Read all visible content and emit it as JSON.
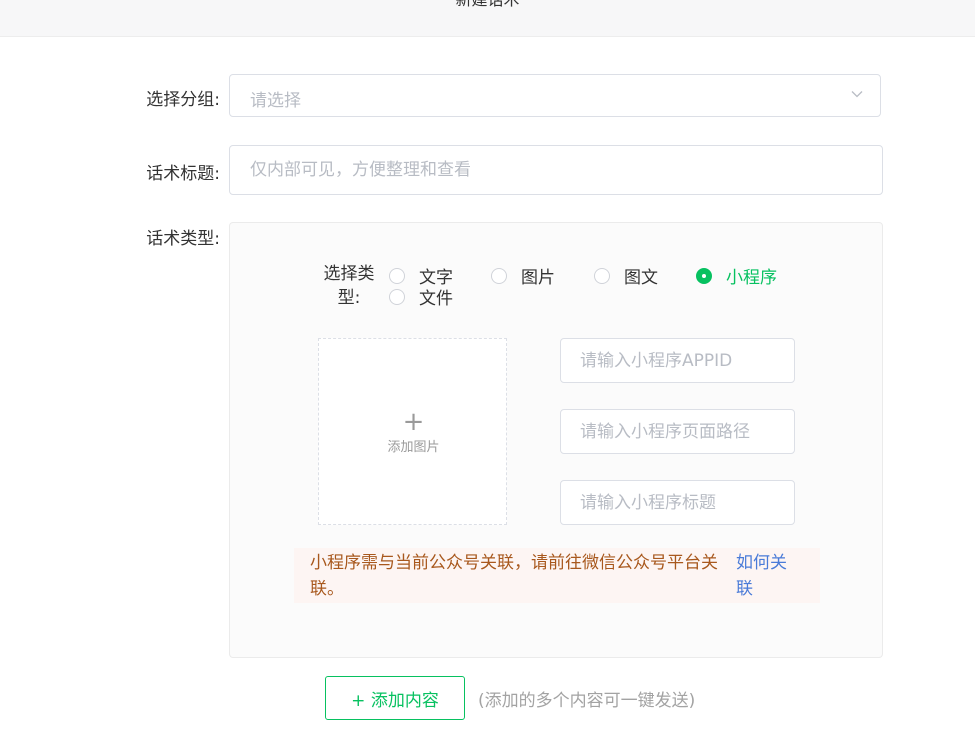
{
  "header": {
    "title": "新建话术"
  },
  "form": {
    "group_label": "选择分组:",
    "group_placeholder": "请选择",
    "title_label": "话术标题:",
    "title_placeholder": "仅内部可见，方便整理和查看",
    "type_label": "话术类型:"
  },
  "content": {
    "select_type_label": "选择类型:",
    "types": [
      {
        "label": "文字",
        "checked": false
      },
      {
        "label": "图片",
        "checked": false
      },
      {
        "label": "图文",
        "checked": false
      },
      {
        "label": "小程序",
        "checked": true
      },
      {
        "label": "文件",
        "checked": false
      }
    ],
    "upload_label": "添加图片",
    "upload_icon": "plus-icon",
    "appid_placeholder": "请输入小程序APPID",
    "path_placeholder": "请输入小程序页面路径",
    "mp_title_placeholder": "请输入小程序标题",
    "warning_text": "小程序需与当前公众号关联，请前往微信公众号平台关联。",
    "warning_link": "如何关联"
  },
  "footer": {
    "add_button": "+ 添加内容",
    "hint": "(添加的多个内容可一键发送)"
  },
  "colors": {
    "accent": "#07c160",
    "link": "#4a7bd8",
    "warning_text": "#a8581d",
    "warning_bg": "#fdf5f3"
  }
}
